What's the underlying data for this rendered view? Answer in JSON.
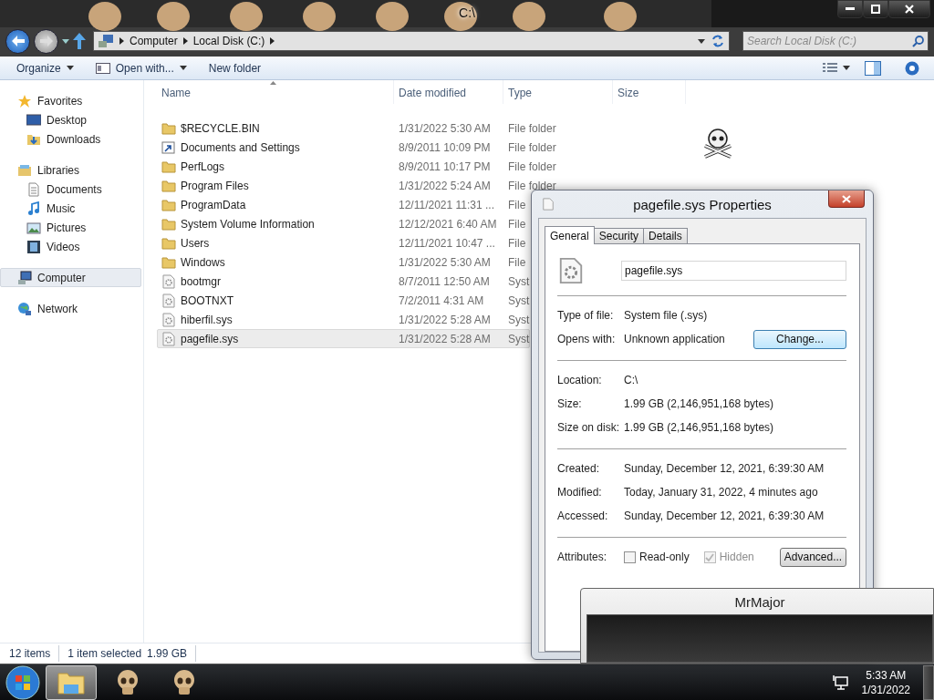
{
  "window": {
    "title": "C:\\"
  },
  "address_bar": {
    "crumbs": [
      "Computer",
      "Local Disk (C:)"
    ]
  },
  "search": {
    "placeholder": "Search Local Disk (C:)"
  },
  "toolbar": {
    "items": [
      {
        "kind": "menu",
        "label": "Organize"
      },
      {
        "kind": "menu",
        "label": "Open with..."
      },
      {
        "kind": "button",
        "label": "New folder"
      }
    ]
  },
  "sidebar": {
    "groups": [
      {
        "label": "Favorites",
        "selected": false,
        "children": [
          {
            "label": "Desktop",
            "selected": false
          },
          {
            "label": "Downloads",
            "selected": false
          }
        ]
      },
      {
        "label": "Libraries",
        "selected": false,
        "children": [
          {
            "label": "Documents",
            "selected": false
          },
          {
            "label": "Music",
            "selected": false
          },
          {
            "label": "Pictures",
            "selected": false
          },
          {
            "label": "Videos",
            "selected": false
          }
        ]
      },
      {
        "label": "Computer",
        "selected": true
      },
      {
        "label": "Network",
        "selected": false
      }
    ]
  },
  "table": {
    "columns": [
      "Name",
      "Date modified",
      "Type",
      "Size"
    ],
    "rows": [
      {
        "kind": "folder",
        "name": "$RECYCLE.BIN",
        "date": "1/31/2022 5:30 AM",
        "type": "File folder",
        "selected": false
      },
      {
        "kind": "shortcut",
        "name": "Documents and Settings",
        "date": "8/9/2011 10:09 PM",
        "type": "File folder",
        "selected": false
      },
      {
        "kind": "folder",
        "name": "PerfLogs",
        "date": "8/9/2011 10:17 PM",
        "type": "File folder",
        "selected": false
      },
      {
        "kind": "folder",
        "name": "Program Files",
        "date": "1/31/2022 5:24 AM",
        "type": "File folder",
        "selected": false
      },
      {
        "kind": "folder",
        "name": "ProgramData",
        "date": "12/11/2021 11:31 ...",
        "type": "File",
        "selected": false
      },
      {
        "kind": "folder",
        "name": "System Volume Information",
        "date": "12/12/2021 6:40 AM",
        "type": "File",
        "selected": false
      },
      {
        "kind": "folder",
        "name": "Users",
        "date": "12/11/2021 10:47 ...",
        "type": "File",
        "selected": false
      },
      {
        "kind": "folder",
        "name": "Windows",
        "date": "1/31/2022 5:30 AM",
        "type": "File",
        "selected": false
      },
      {
        "kind": "file",
        "name": "bootmgr",
        "date": "8/7/2011 12:50 AM",
        "type": "Syst",
        "selected": false
      },
      {
        "kind": "file",
        "name": "BOOTNXT",
        "date": "7/2/2011 4:31 AM",
        "type": "Syst",
        "selected": false
      },
      {
        "kind": "file",
        "name": "hiberfil.sys",
        "date": "1/31/2022 5:28 AM",
        "type": "Syst",
        "selected": false
      },
      {
        "kind": "file",
        "name": "pagefile.sys",
        "date": "1/31/2022 5:28 AM",
        "type": "Syst",
        "selected": true
      }
    ]
  },
  "status_bar": {
    "count": "12 items",
    "selection": "1 item selected",
    "size": "1.99 GB"
  },
  "dialog": {
    "title": "pagefile.sys Properties",
    "tabs": [
      {
        "label": "General",
        "selected": true
      },
      {
        "label": "Security",
        "selected": false
      },
      {
        "label": "Details",
        "selected": false
      }
    ],
    "file_name": "pagefile.sys",
    "sections": [
      [
        {
          "label": "Type of file:",
          "value": "System file (.sys)"
        },
        {
          "label": "Opens with:",
          "value": "Unknown application",
          "button": {
            "label": "Change...",
            "focused": true
          }
        }
      ],
      [
        {
          "label": "Location:",
          "value": "C:\\"
        },
        {
          "label": "Size:",
          "value": "1.99 GB (2,146,951,168 bytes)"
        },
        {
          "label": "Size on disk:",
          "value": "1.99 GB (2,146,951,168 bytes)"
        }
      ],
      [
        {
          "label": "Created:",
          "value": "Sunday, December 12, 2021, 6:39:30 AM"
        },
        {
          "label": "Modified:",
          "value": "Today, January 31, 2022, 4 minutes ago"
        },
        {
          "label": "Accessed:",
          "value": "Sunday, December 12, 2021, 6:39:30 AM"
        }
      ]
    ],
    "attributes": {
      "label": "Attributes:",
      "options": [
        {
          "label": "Read-only",
          "checked": false,
          "disabled": false
        },
        {
          "label": "Hidden",
          "checked": true,
          "disabled": true
        }
      ],
      "button": {
        "label": "Advanced...",
        "focused": false
      }
    }
  },
  "overlay_window": {
    "title": "MrMajor"
  },
  "taskbar": {
    "apps": [
      {
        "selected": true
      },
      {
        "selected": false
      },
      {
        "selected": false
      }
    ],
    "time": "5:33 AM",
    "date": "1/31/2022"
  }
}
